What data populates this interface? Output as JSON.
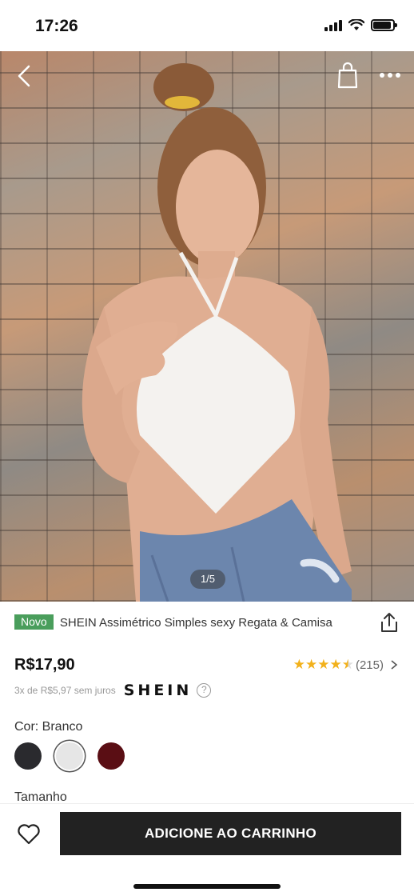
{
  "status_bar": {
    "time": "17:26",
    "battery_level": 0.9
  },
  "product": {
    "badge": "Novo",
    "title": "SHEIN Assimétrico Simples sexy Regata & Camisa",
    "price": "R$17,90",
    "rating_stars": 4.5,
    "rating_count": "(215)",
    "installments": "3x de R$5,97 sem juros",
    "brand_logo": "SHEIN",
    "help_glyph": "?",
    "image_indicator": "1/5"
  },
  "color": {
    "label": "Cor: Branco",
    "options": [
      {
        "name": "black",
        "hex": "#2a2a2e"
      },
      {
        "name": "white",
        "hex": "#e6e6e6",
        "selected": true
      },
      {
        "name": "burgundy",
        "hex": "#5a0e14"
      }
    ]
  },
  "size": {
    "label": "Tamanho"
  },
  "actions": {
    "add_to_cart": "ADICIONE AO CARRINHO"
  },
  "icons": [
    "back-icon",
    "bag-icon",
    "more-icon",
    "share-icon",
    "heart-icon",
    "chevron-right-icon",
    "help-icon"
  ],
  "colors": {
    "badge": "#4a9e5c",
    "star": "#f2b11b",
    "cart_button": "#222222"
  }
}
